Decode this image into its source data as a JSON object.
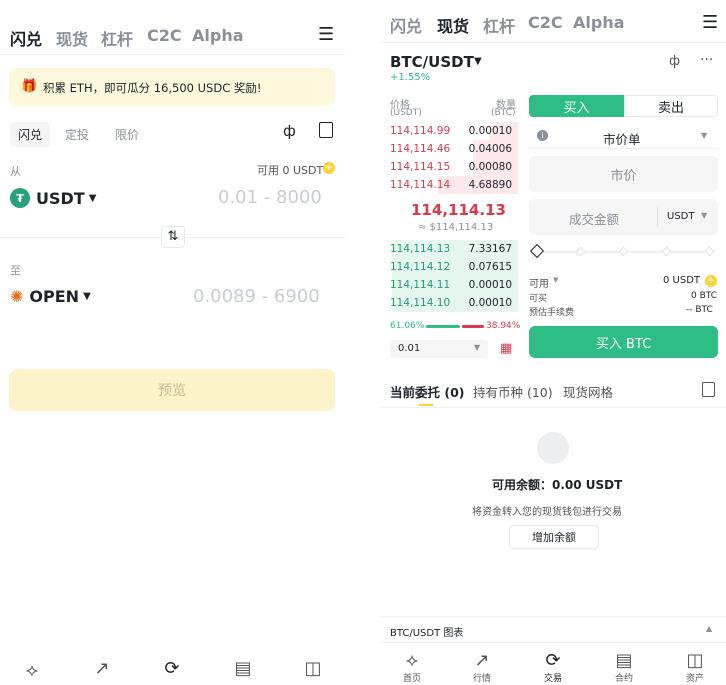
{
  "left": {
    "tabs": [
      "闪兑",
      "现货",
      "杠杆",
      "C2C",
      "Alpha"
    ],
    "banner": "积累 ETH，即可瓜分 16,500 USDC 奖励!",
    "modes": [
      "闪兑",
      "定投",
      "限价"
    ],
    "from_label": "从",
    "available": "可用 0 USDT",
    "from_coin": "USDT",
    "from_range": "0.01 - 8000",
    "to_label": "至",
    "to_coin": "OPEN",
    "to_range": "0.0089 - 6900",
    "preview": "预览"
  },
  "right": {
    "tabs": [
      "闪兑",
      "现货",
      "杠杆",
      "C2C",
      "Alpha"
    ],
    "pair": "BTC/USDT",
    "change": "+1.55%",
    "price_header": "价格",
    "price_unit": "(USDT)",
    "qty_header": "数量",
    "qty_unit": "(BTC)",
    "asks": [
      {
        "price": "114,114.99",
        "qty": "0.00010"
      },
      {
        "price": "114,114.46",
        "qty": "0.04006"
      },
      {
        "price": "114,114.15",
        "qty": "0.00080"
      },
      {
        "price": "114,114.14",
        "qty": "4.68890"
      }
    ],
    "last_price": "114,114.13",
    "last_price_usd": "≈ $114,114.13",
    "bids": [
      {
        "price": "114,114.13",
        "qty": "7.33167"
      },
      {
        "price": "114,114.12",
        "qty": "0.07615"
      },
      {
        "price": "114,114.11",
        "qty": "0.00010"
      },
      {
        "price": "114,114.10",
        "qty": "0.00010"
      }
    ],
    "buy_ratio": "61.06%",
    "sell_ratio": "38.94%",
    "depth": "0.01",
    "buy_tab": "买入",
    "sell_tab": "卖出",
    "order_type": "市价单",
    "market_price": "市价",
    "amount_placeholder": "成交金额",
    "amount_unit": "USDT",
    "available_label": "可用",
    "available_value": "0 USDT",
    "can_buy_label": "可买",
    "can_buy_value": "0 BTC",
    "fee_label": "预估手续费",
    "fee_value": "-- BTC",
    "buy_button": "买入 BTC",
    "order_tabs": [
      "当前委托 (0)",
      "持有币种 (10)",
      "现货网格"
    ],
    "empty_balance": "可用余额：0.00 USDT",
    "empty_hint": "将资金转入您的现货钱包进行交易",
    "add_balance": "增加余额",
    "chart_bar": "BTC/USDT 图表"
  },
  "nav": [
    "首页",
    "行情",
    "交易",
    "合约",
    "资产"
  ],
  "colors": {
    "buy": "#2dbd85",
    "sell": "#e0364b",
    "yellow": "#fcd535",
    "banner": "#fdf7dc"
  }
}
